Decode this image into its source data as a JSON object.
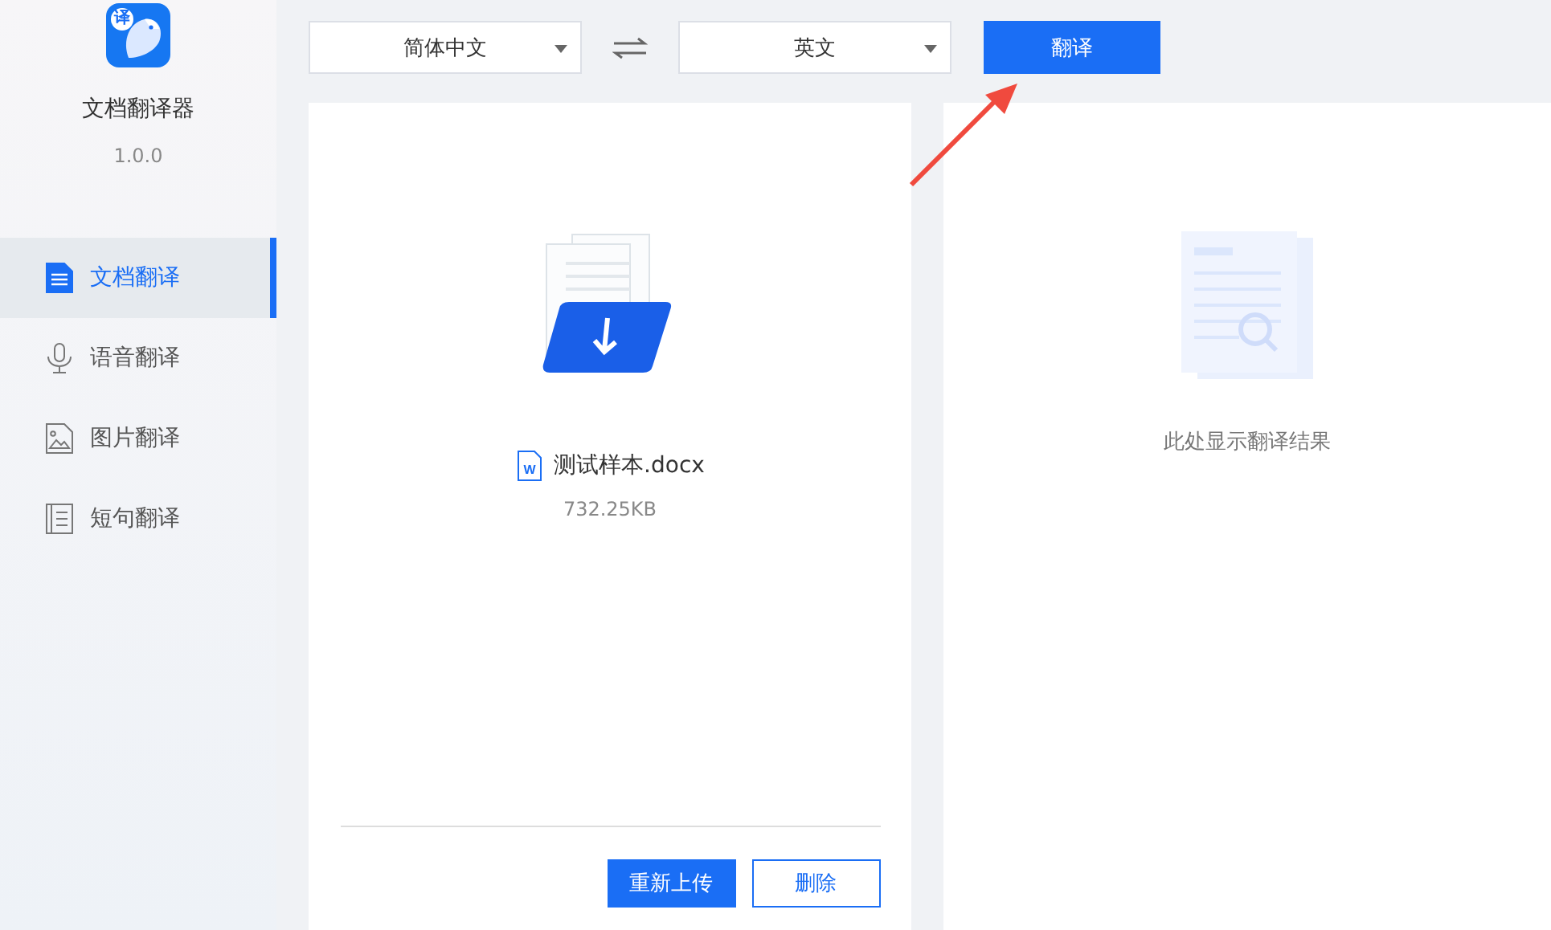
{
  "app": {
    "logo_badge": "译",
    "name": "文档翻译器",
    "version": "1.0.0"
  },
  "nav": [
    {
      "kind": "document",
      "label": "文档翻译",
      "selected": true
    },
    {
      "kind": "voice",
      "label": "语音翻译",
      "selected": false
    },
    {
      "kind": "image",
      "label": "图片翻译",
      "selected": false
    },
    {
      "kind": "sentence",
      "label": "短句翻译",
      "selected": false
    }
  ],
  "toolbar": {
    "source_language": "简体中文",
    "target_language": "英文",
    "translate_button": "翻译"
  },
  "source_panel": {
    "file_type_badge": "W",
    "file_name": "测试样本.docx",
    "file_size": "732.25KB",
    "buttons": [
      "重新上传",
      "删除"
    ]
  },
  "result_panel": {
    "empty_hint": "此处显示翻译结果"
  }
}
